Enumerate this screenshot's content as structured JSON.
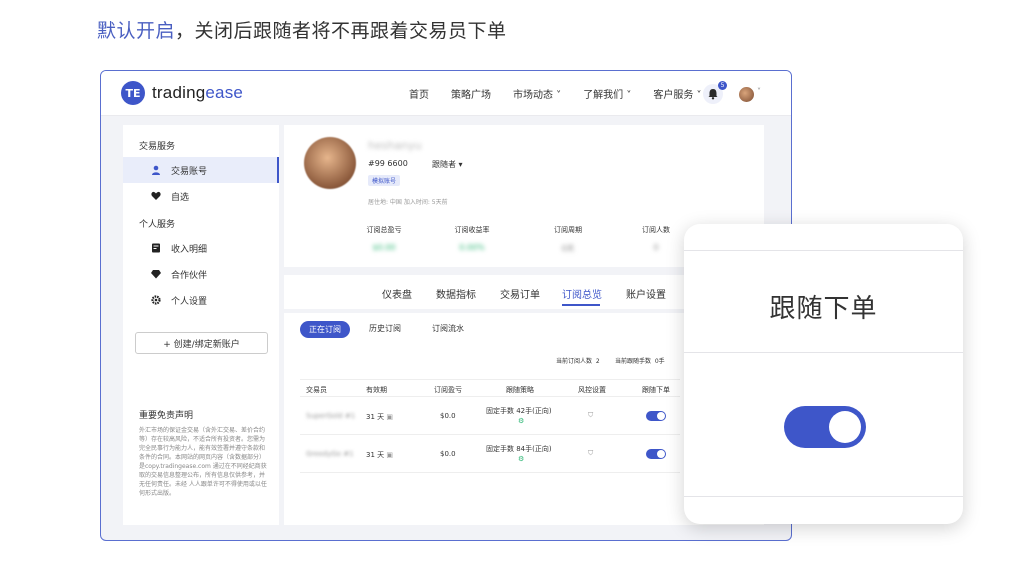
{
  "caption": {
    "highlight": "默认开启",
    "rest": "，关闭后跟随者将不再跟着交易员下单"
  },
  "brand": {
    "badge": "TE",
    "name_a": "trading",
    "name_b": "ease"
  },
  "nav": {
    "items": [
      "首页",
      "策略广场",
      "市场动态 ˅",
      "了解我们 ˅",
      "客户服务 ˅"
    ],
    "notif_count": "5"
  },
  "sidebar": {
    "group1": "交易服务",
    "items1": [
      "交易账号",
      "自选"
    ],
    "group2": "个人服务",
    "items2": [
      "收入明细",
      "合作伙伴",
      "个人设置"
    ],
    "create_label": "+ 创建/绑定新账户",
    "disclaimer_title": "重要免责声明",
    "disclaimer_text": "外汇市场的保证金交易（含外汇交易、差价合约等）存在较高风险，不适合所有投资者。您需为完全民事行为能力人，能有效签署并遵守条款和条件的合同。本网站的网页内容（含数据部分）是copy.tradingease.com 通过在不同经纪商获取的交易信息整理公布，所有信息仅供参考，并无任何责任。未经 人人跟单许可不得使用或以任何形式出版。"
  },
  "profile": {
    "name": "heshanyu",
    "id": "#99   6600",
    "role": "跟随者 ▾",
    "tag": "模拟账号",
    "meta": "居住地: 中国            加入时间: 5天前",
    "stats": [
      {
        "label": "订阅总盈亏",
        "value": "$0.00"
      },
      {
        "label": "订阅收益率",
        "value": "0.00%"
      },
      {
        "label": "订阅周期",
        "value": "0天"
      },
      {
        "label": "订阅人数",
        "value": "0"
      }
    ]
  },
  "tabs": [
    "仪表盘",
    "数据指标",
    "交易订单",
    "订阅总览",
    "账户设置"
  ],
  "subtabs": [
    "正在订阅",
    "历史订阅",
    "订阅流水"
  ],
  "summary": {
    "subs_label": "当前订阅人数",
    "subs_value": "2",
    "hands_label": "当前跟随手数",
    "hands_value": "0手"
  },
  "table": {
    "headers": [
      "交易员",
      "有效期",
      "订阅盈亏",
      "跟随策略",
      "风控设置",
      "跟随下单"
    ],
    "rows": [
      {
        "trader": "SuperGold #1",
        "validity": "31 天",
        "pnl": "$0.0",
        "strategy": "固定手数 42手(正向)"
      },
      {
        "trader": "GreedyGo #1",
        "validity": "31 天",
        "pnl": "$0.0",
        "strategy": "固定手数 84手(正向)"
      }
    ]
  },
  "card": {
    "title": "跟随下单",
    "toggle_state": "on"
  },
  "colors": {
    "accent": "#3e56c9"
  }
}
